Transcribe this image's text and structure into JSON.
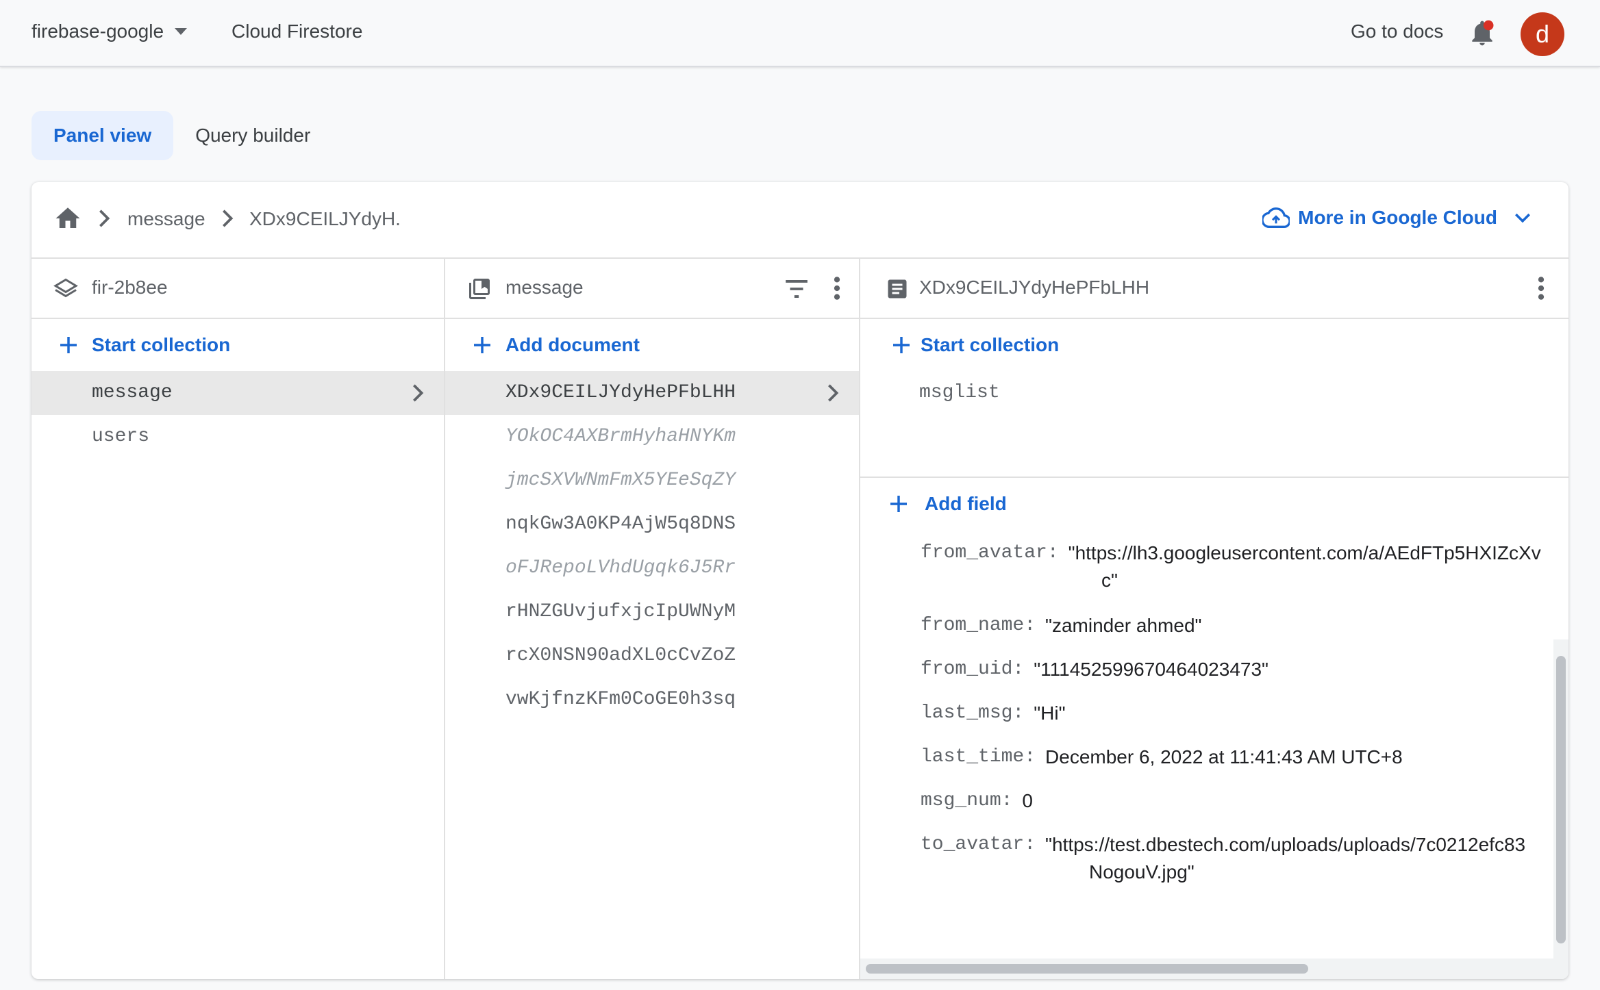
{
  "topbar": {
    "project": "firebase-google",
    "product": "Cloud Firestore",
    "docs_link": "Go to docs",
    "avatar_letter": "d",
    "avatar_color": "#c5381a"
  },
  "tabs": [
    {
      "label": "Panel view",
      "active": true
    },
    {
      "label": "Query builder",
      "active": false
    }
  ],
  "breadcrumb": {
    "items": [
      "message",
      "XDx9CEILJYdyH."
    ],
    "cloud_link": "More in Google Cloud"
  },
  "columns": {
    "root": {
      "title": "fir-2b8ee",
      "action": "Start collection",
      "items": [
        {
          "label": "message",
          "selected": true
        },
        {
          "label": "users",
          "selected": false
        }
      ]
    },
    "collection": {
      "title": "message",
      "action": "Add document",
      "items": [
        {
          "label": "XDx9CEILJYdyHePFbLHH",
          "selected": true,
          "italic": false
        },
        {
          "label": "YOkOC4AXBrmHyhaHNYKm",
          "selected": false,
          "italic": true
        },
        {
          "label": "jmcSXVWNmFmX5YEeSqZY",
          "selected": false,
          "italic": true
        },
        {
          "label": "nqkGw3A0KP4AjW5q8DNS",
          "selected": false,
          "italic": false
        },
        {
          "label": "oFJRepoLVhdUgqk6J5Rr",
          "selected": false,
          "italic": true
        },
        {
          "label": "rHNZGUvjufxjcIpUWNyM",
          "selected": false,
          "italic": false
        },
        {
          "label": "rcX0NSN90adXL0cCvZoZ",
          "selected": false,
          "italic": false
        },
        {
          "label": "vwKjfnzKFm0CoGE0h3sq",
          "selected": false,
          "italic": false
        }
      ]
    },
    "document": {
      "title": "XDx9CEILJYdyHePFbLHH",
      "action": "Start collection",
      "subcollections": [
        "msglist"
      ],
      "add_field": "Add field",
      "fields": [
        {
          "key": "from_avatar:",
          "value": "\"https://lh3.googleusercontent.com/a/AEdFTp5HXIZcXv",
          "value2": "c\""
        },
        {
          "key": "from_name:",
          "value": "\"zaminder ahmed\""
        },
        {
          "key": "from_uid:",
          "value": "\"111452599670464023473\""
        },
        {
          "key": "last_msg:",
          "value": "\"Hi\""
        },
        {
          "key": "last_time:",
          "value": "December 6, 2022 at 11:41:43 AM UTC+8"
        },
        {
          "key": "msg_num:",
          "value": "0"
        },
        {
          "key": "to_avatar:",
          "value": "\"https://test.dbestech.com/uploads/uploads/7c0212efc83",
          "value2": "NogouV.jpg\""
        }
      ]
    }
  }
}
